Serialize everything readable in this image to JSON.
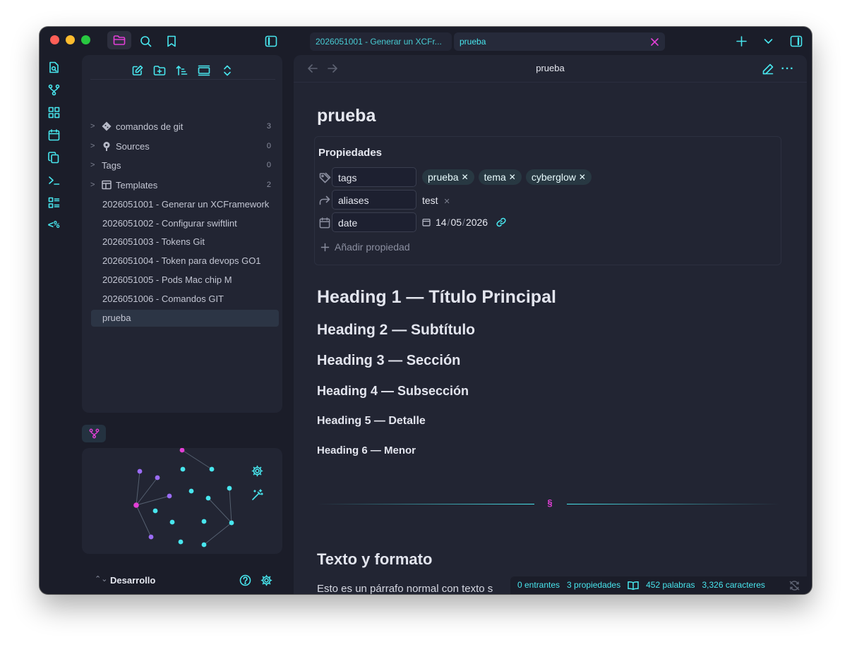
{
  "tabs": [
    {
      "label": "2026051001 - Generar un XCFr...",
      "active": false
    },
    {
      "label": "prueba",
      "active": true
    }
  ],
  "sidebar": {
    "folders": [
      {
        "label": "comandos de git",
        "count": "3",
        "icon": "git-diamond-icon"
      },
      {
        "label": "Sources",
        "count": "0",
        "icon": "pin-icon"
      },
      {
        "label": "Tags",
        "count": "0",
        "icon": ""
      },
      {
        "label": "Templates",
        "count": "2",
        "icon": "template-icon"
      }
    ],
    "files": [
      "2026051001 - Generar un XCFramework",
      "2026051002 - Configurar swiftlint",
      "2026051003 - Tokens Git",
      "2026051004 - Token para devops GO1",
      "2026051005 - Pods Mac chip M",
      "2026051006 - Comandos GIT",
      "prueba"
    ],
    "vault_name": "Desarrollo"
  },
  "note": {
    "header_title": "prueba",
    "title": "prueba",
    "properties_label": "Propiedades",
    "properties": {
      "tags_key": "tags",
      "tags": [
        "prueba",
        "tema",
        "cyberglow"
      ],
      "aliases_key": "aliases",
      "alias_value": "test",
      "date_key": "date",
      "date_day": "14",
      "date_month": "05",
      "date_year": "2026",
      "add_label": "Añadir propiedad"
    },
    "headings": [
      "Heading 1 — Título Principal",
      "Heading 2 — Subtítulo",
      "Heading 3 — Sección",
      "Heading 4 — Subsección",
      "Heading 5 — Detalle",
      "Heading 6 — Menor"
    ],
    "section_title": "Texto y formato",
    "paragraph_start": "Esto es un párrafo normal con texto s"
  },
  "status": {
    "backlinks": "0 entrantes",
    "properties": "3 propiedades",
    "words": "452 palabras",
    "chars": "3,326 caracteres"
  },
  "colors": {
    "background": "#1b1d29",
    "panel": "#222533",
    "accent_cyan": "#48e6ee",
    "accent_magenta": "#e23fd6",
    "node_purple": "#9b6cf6"
  }
}
